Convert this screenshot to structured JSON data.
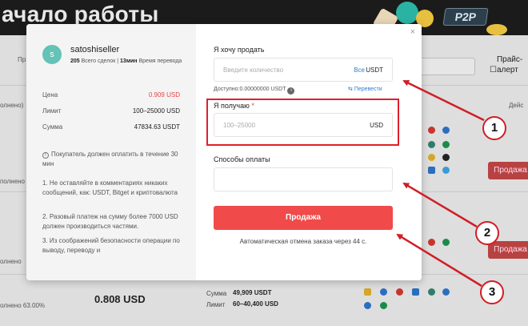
{
  "background": {
    "banner_title": "ачало работы",
    "badge": "P2P",
    "filter_checkbox_label": "Прайс-алерт",
    "column_left_fragment": "Пр",
    "column_left_fragment2": "олнено)",
    "column_action": "Дейс",
    "row_left_fragment1": "полнено",
    "row_left_fragment2": "олнено",
    "row_left_fragment3": "олнено 63.00%",
    "row_price": "0.808 USD",
    "row_amount_label": "Сумма",
    "row_amount_value": "49,909 USDT",
    "row_limit_label": "Лимит",
    "row_limit_value": "60–40,400 USD",
    "row_sell_button": "Продажа"
  },
  "modal": {
    "seller": {
      "avatar_letter": "s",
      "name": "satoshiseller",
      "deals_count": "205",
      "deals_label": "Всего сделок",
      "separator": " | ",
      "time_value": "13мин",
      "time_label": "Время перевода"
    },
    "info": [
      {
        "label": "Цена",
        "value": "0.909 USD"
      },
      {
        "label": "Лимит",
        "value": "100–25000 USD"
      },
      {
        "label": "Сумма",
        "value": "47834.63 USDT"
      }
    ],
    "notice_title": "Покупатель должен оплатить в течение 30 мин",
    "notice_items": [
      "1. Не оставляйте в комментариях никаких сообщений, как: USDT, Bitget и криптовалюта",
      "2. Разовый платеж на сумму более 7000 USD должен производиться частями.",
      "3. Из соображений безопасности операции по выводу, переводу и"
    ],
    "sell_field": {
      "label": "Я хочу продать",
      "placeholder": "Введите количество",
      "all_link": "Все",
      "currency": "USDT"
    },
    "available": {
      "label": "Доступно:",
      "value": "0.00000000 USDT",
      "transfer_link": "Перевести"
    },
    "receive_field": {
      "label": "Я получаю",
      "required_mark": "*",
      "placeholder": "100–25000",
      "currency": "USD"
    },
    "payment_field": {
      "label": "Способы оплаты",
      "value": ""
    },
    "submit_button": "Продажа",
    "auto_cancel_text": "Автоматическая отмена заказа через 44 с.",
    "close": "×"
  },
  "annotations": {
    "callouts": [
      "1",
      "2",
      "3"
    ],
    "color": "#d01e26"
  }
}
